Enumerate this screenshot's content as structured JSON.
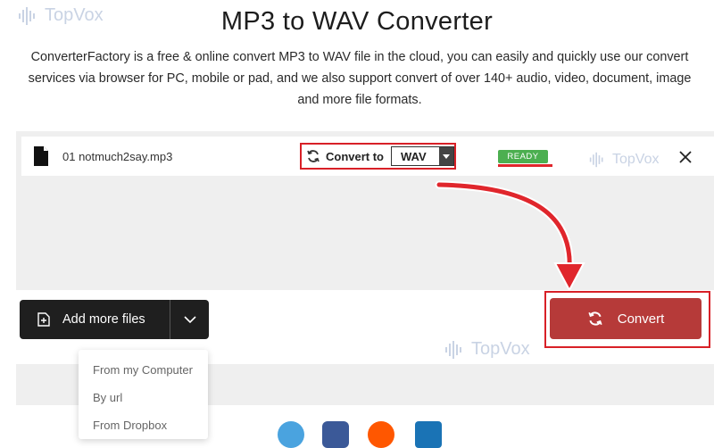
{
  "watermark": {
    "text": "TopVox"
  },
  "page": {
    "title": "MP3 to WAV Converter",
    "description": "ConverterFactory is a free & online convert MP3 to WAV file in the cloud, you can easily and quickly use our convert services via browser for PC, mobile or pad, and we also support convert of over 140+ audio, video, document, image and more file formats."
  },
  "file": {
    "name": "01 notmuch2say.mp3",
    "convert_to_label": "Convert to",
    "format": "WAV",
    "status": "READY"
  },
  "actions": {
    "add_files_label": "Add more files",
    "convert_label": "Convert"
  },
  "add_menu": {
    "items": [
      "From my Computer",
      "By url",
      "From Dropbox"
    ]
  },
  "colors": {
    "highlight": "#d82027",
    "convert": "#b63a39",
    "ready": "#4caf50",
    "add_button": "#1f1f1f",
    "panel": "#efefef"
  },
  "social_icons": [
    "twitter-icon",
    "facebook-icon",
    "reddit-icon",
    "linkedin-icon"
  ]
}
